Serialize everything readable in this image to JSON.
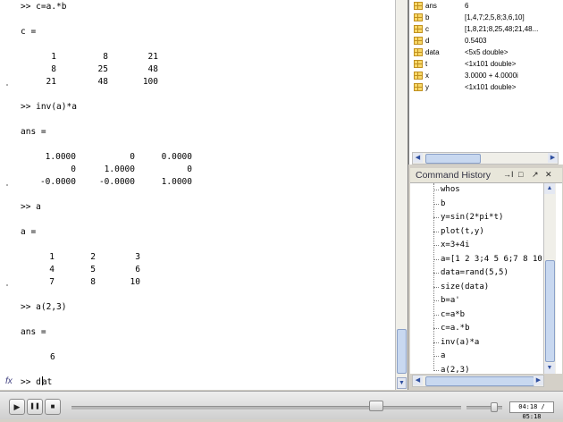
{
  "command_window": {
    "lines": [
      ">> c=a.*b",
      "c =",
      ">> inv(a)*a",
      "ans =",
      ">> a",
      "a =",
      ">> a(2,3)",
      "ans ="
    ],
    "matrix_c": [
      [
        "1",
        "8",
        "21"
      ],
      [
        "8",
        "25",
        "48"
      ],
      [
        "21",
        "48",
        "100"
      ]
    ],
    "matrix_inv": [
      [
        "1.0000",
        "0",
        "0.0000"
      ],
      [
        "0",
        "1.0000",
        "0"
      ],
      [
        "-0.0000",
        "-0.0000",
        "1.0000"
      ]
    ],
    "matrix_a": [
      [
        "1",
        "2",
        "3"
      ],
      [
        "4",
        "5",
        "6"
      ],
      [
        "7",
        "8",
        "10"
      ]
    ],
    "ans_value": "6",
    "prompt": ">> ",
    "current_input_before_caret": "d",
    "current_input_after_caret": "at",
    "fx_glyph": "fx"
  },
  "workspace": {
    "variables": [
      {
        "name": "ans",
        "value": "6"
      },
      {
        "name": "b",
        "value": "[1,4,7;2,5,8;3,6,10]"
      },
      {
        "name": "c",
        "value": "[1,8,21;8,25,48;21,48..."
      },
      {
        "name": "d",
        "value": "0.5403"
      },
      {
        "name": "data",
        "value": "<5x5 double>"
      },
      {
        "name": "t",
        "value": "<1x101 double>"
      },
      {
        "name": "x",
        "value": "3.0000 + 4.0000i"
      },
      {
        "name": "y",
        "value": "<1x101 double>"
      }
    ]
  },
  "history": {
    "title": "Command History",
    "buttons": {
      "dock": "→I",
      "maximize": "□",
      "undock": "↗",
      "close": "✕"
    },
    "items": [
      "whos",
      "b",
      "y=sin(2*pi*t)",
      "plot(t,y)",
      "x=3+4i",
      "a=[1 2 3;4 5 6;7 8 10]",
      "data=rand(5,5)",
      "size(data)",
      "b=a'",
      "c=a*b",
      "c=a.*b",
      "inv(a)*a",
      "a",
      "a(2,3)"
    ]
  },
  "player": {
    "play": "▶",
    "pause": "❚❚",
    "stop": "■",
    "time": "04:18 / 05:18",
    "progress_fraction": 0.78,
    "volume_fraction": 0.75
  }
}
